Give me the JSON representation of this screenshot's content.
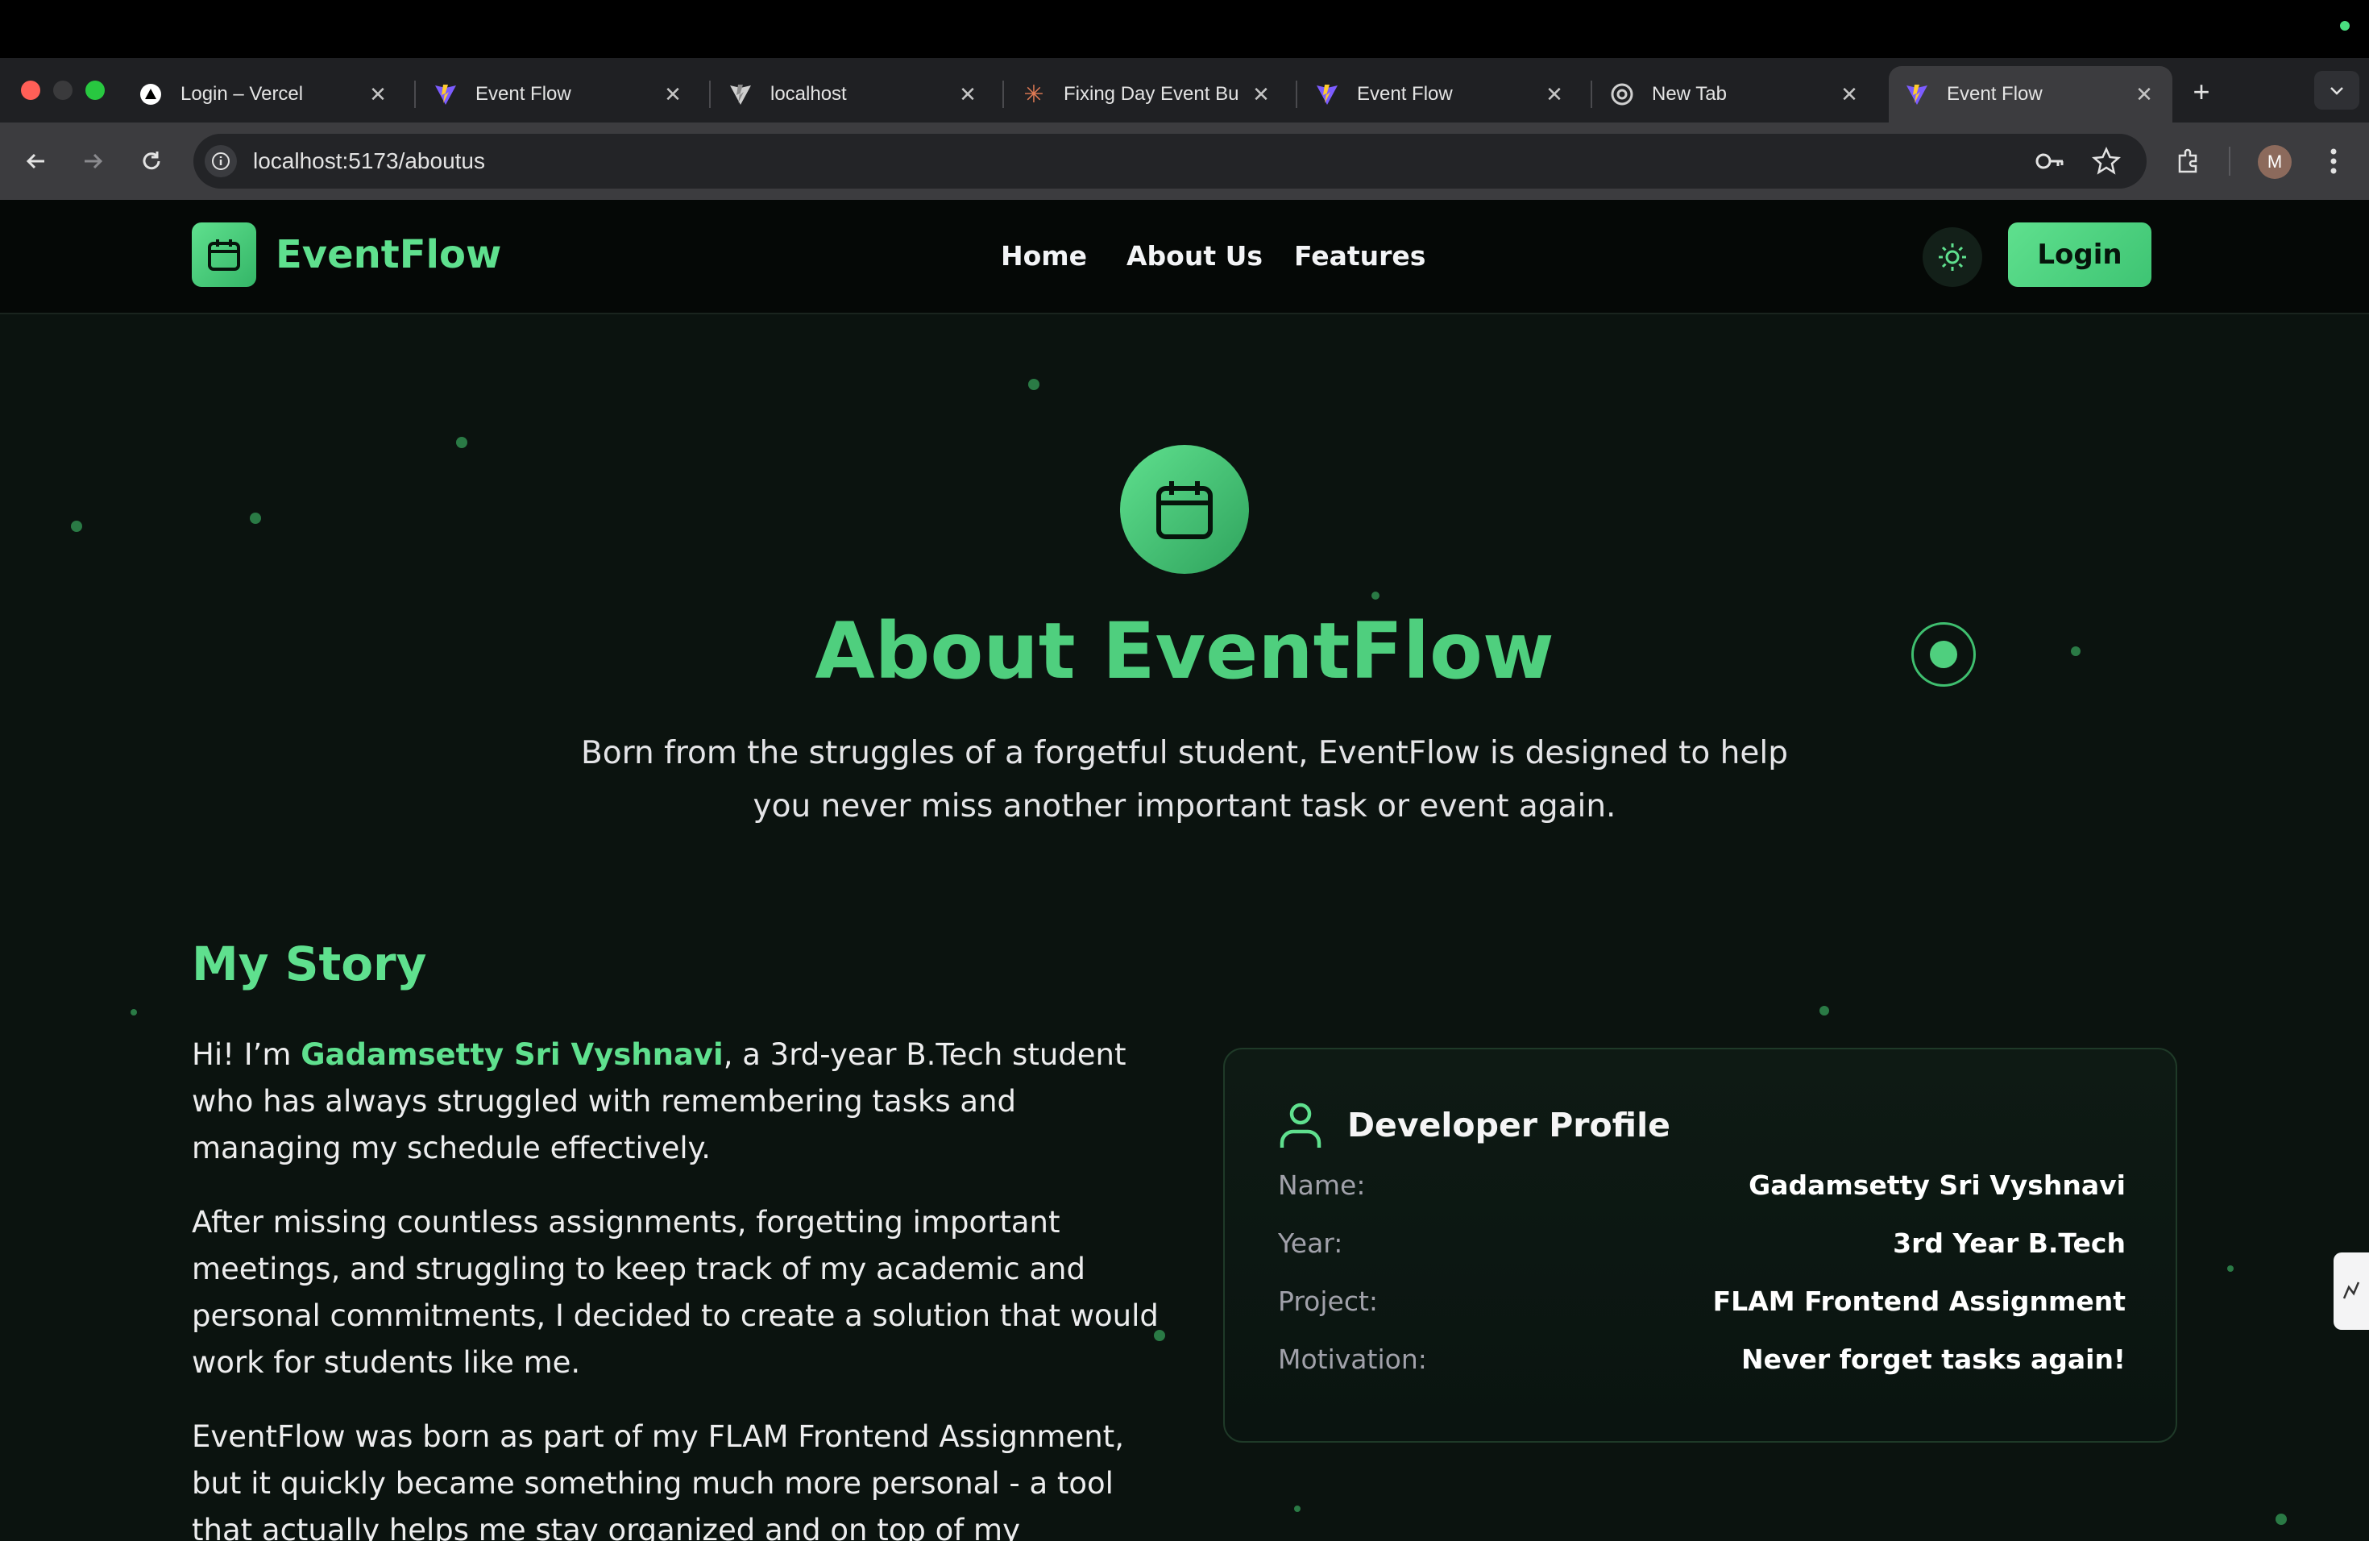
{
  "browser": {
    "tabs": [
      {
        "title": "Login – Vercel",
        "icon": "vercel-icon"
      },
      {
        "title": "Event Flow",
        "icon": "vite-icon"
      },
      {
        "title": "localhost",
        "icon": "vite-grey-icon"
      },
      {
        "title": "Fixing Day Event Bu",
        "icon": "claude-icon"
      },
      {
        "title": "Event Flow",
        "icon": "vite-icon"
      },
      {
        "title": "New Tab",
        "icon": "chrome-icon"
      },
      {
        "title": "Event Flow",
        "icon": "vite-icon",
        "active": true
      }
    ],
    "url": "localhost:5173/aboutus",
    "profile_initial": "M"
  },
  "navbar": {
    "brand": "EventFlow",
    "links": [
      "Home",
      "About Us",
      "Features"
    ],
    "login_label": "Login"
  },
  "hero": {
    "title": "About EventFlow",
    "subtitle_line1": "Born from the struggles of a forgetful student, EventFlow is designed to help",
    "subtitle_line2": "you never miss another important task or event again."
  },
  "story": {
    "title": "My Story",
    "p1_prefix": "Hi! I’m ",
    "p1_name": "Gadamsetty Sri Vyshnavi",
    "p1_suffix": ", a 3rd-year B.Tech student who has always struggled with remembering tasks and managing my schedule effectively.",
    "p2": "After missing countless assignments, forgetting important meetings, and struggling to keep track of my academic and personal commitments, I decided to create a solution that would work for students like me.",
    "p3": "EventFlow was born as part of my FLAM Frontend Assignment, but it quickly became something much more personal - a tool that actually helps me stay organized and on top of my responsibilities."
  },
  "profile": {
    "title": "Developer Profile",
    "rows": [
      {
        "label": "Name:",
        "value": "Gadamsetty Sri Vyshnavi"
      },
      {
        "label": "Year:",
        "value": "3rd Year B.Tech"
      },
      {
        "label": "Project:",
        "value": "FLAM Frontend Assignment"
      },
      {
        "label": "Motivation:",
        "value": "Never forget tasks again!"
      }
    ]
  },
  "colors": {
    "accent": "#5fe08e",
    "background": "#0b130f",
    "navbar": "#050806"
  }
}
